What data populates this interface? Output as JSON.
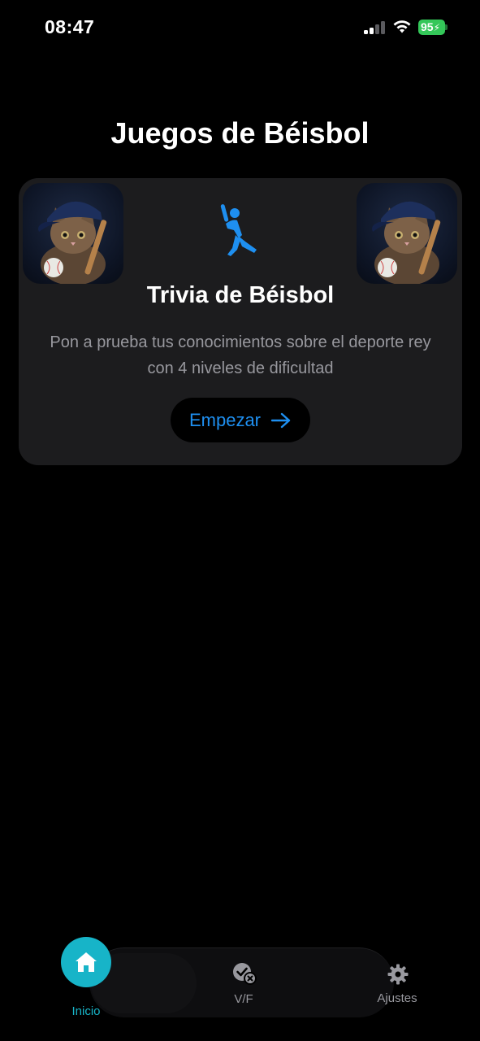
{
  "status_bar": {
    "time": "08:47",
    "battery": "95",
    "icons": [
      "cellular-signal-icon",
      "wifi-icon",
      "battery-charging-icon"
    ]
  },
  "header": {
    "title": "Juegos de Béisbol"
  },
  "game_card": {
    "title": "Trivia de Béisbol",
    "description": "Pon a prueba tus conocimientos sobre el deporte rey con 4 niveles de dificultad",
    "start_label": "Empezar",
    "icon": "baseball-batter-icon",
    "accent_color": "#1e8ff0",
    "card_color": "#1c1c1e"
  },
  "tab_bar": {
    "active_color": "#17b4c8",
    "inactive_color": "#98989e",
    "items": [
      {
        "label": "Inicio",
        "icon": "home-icon",
        "active": true
      },
      {
        "label": "V/F",
        "icon": "checkmark-x-icon",
        "active": false
      },
      {
        "label": "Ajustes",
        "icon": "gear-icon",
        "active": false
      }
    ]
  }
}
